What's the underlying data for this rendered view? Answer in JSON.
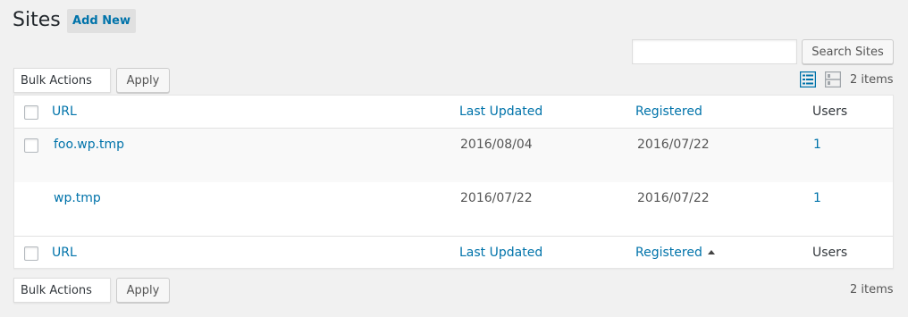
{
  "header": {
    "title": "Sites",
    "add_new_label": "Add New"
  },
  "search": {
    "value": "",
    "button_label": "Search Sites"
  },
  "bulk_top": {
    "select_value": "Bulk Actions",
    "apply_label": "Apply"
  },
  "bulk_bottom": {
    "select_value": "Bulk Actions",
    "apply_label": "Apply"
  },
  "view_modes": {
    "active": "list",
    "icons": [
      "list-view-icon",
      "excerpt-view-icon"
    ]
  },
  "count_top": "2 items",
  "count_bottom": "2 items",
  "table": {
    "columns": [
      "URL",
      "Last Updated",
      "Registered",
      "Users"
    ],
    "footer_columns": [
      "URL",
      "Last Updated",
      "Registered",
      "Users"
    ],
    "sorted_column": "Registered",
    "sort_direction": "asc",
    "rows": [
      {
        "url": "foo.wp.tmp",
        "last_updated": "2016/08/04",
        "registered": "2016/07/22",
        "users": "1",
        "has_checkbox": true
      },
      {
        "url": "wp.tmp",
        "last_updated": "2016/07/22",
        "registered": "2016/07/22",
        "users": "1",
        "has_checkbox": false
      }
    ]
  },
  "colors": {
    "link": "#0073aa",
    "background": "#f1f1f1",
    "active_icon": "#0073aa"
  }
}
